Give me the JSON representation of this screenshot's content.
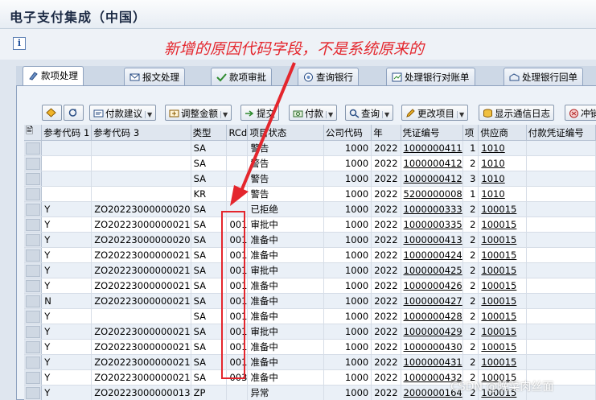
{
  "window": {
    "title": "电子支付集成（中国）"
  },
  "annotation": {
    "text": "新增的原因代码字段，不是系统原来的"
  },
  "tabs": [
    {
      "label": "款项处理",
      "icon": "pen-hand-icon"
    },
    {
      "label": "报文处理",
      "icon": "message-icon"
    },
    {
      "label": "款项审批",
      "icon": "approve-icon"
    },
    {
      "label": "查询银行",
      "icon": "bank-query-icon"
    },
    {
      "label": "处理银行对账单",
      "icon": "statement-icon"
    },
    {
      "label": "处理银行回单",
      "icon": "receipt-icon"
    }
  ],
  "toolbar": {
    "buttons": [
      {
        "label": "",
        "icon": "select-all-icon"
      },
      {
        "label": "",
        "icon": "refresh-icon"
      },
      {
        "label": "付款建议",
        "icon": "payment-proposal-icon"
      },
      {
        "label": "调整金额",
        "icon": "adjust-amount-icon"
      },
      {
        "label": "提交",
        "icon": "submit-icon"
      },
      {
        "label": "付款",
        "icon": "pay-icon"
      },
      {
        "label": "查询",
        "icon": "query-icon"
      },
      {
        "label": "更改项目",
        "icon": "edit-item-icon"
      },
      {
        "label": "显示通信日志",
        "icon": "log-icon"
      },
      {
        "label": "冲销",
        "icon": "reverse-icon"
      }
    ]
  },
  "grid": {
    "columns": [
      "参考代码 1",
      "参考代码 3",
      "类型",
      "RCd",
      "项目状态",
      "公司代码",
      "年",
      "凭证编号",
      "项",
      "供应商",
      "付款凭证编号"
    ],
    "rows": [
      [
        "",
        "",
        "SA",
        "",
        "警告",
        "1000",
        "2022",
        "1000000411",
        "1",
        "1010",
        ""
      ],
      [
        "",
        "",
        "SA",
        "",
        "警告",
        "1000",
        "2022",
        "1000000412",
        "2",
        "1010",
        ""
      ],
      [
        "",
        "",
        "SA",
        "",
        "警告",
        "1000",
        "2022",
        "1000000412",
        "3",
        "1010",
        ""
      ],
      [
        "",
        "",
        "KR",
        "",
        "警告",
        "1000",
        "2022",
        "5200000008",
        "1",
        "1010",
        ""
      ],
      [
        "Y",
        "ZO20223000000020",
        "SA",
        "",
        "已拒绝",
        "1000",
        "2022",
        "1000000333",
        "2",
        "100015",
        ""
      ],
      [
        "Y",
        "ZO20223000000021",
        "SA",
        "001",
        "审批中",
        "1000",
        "2022",
        "1000000335",
        "2",
        "100015",
        ""
      ],
      [
        "Y",
        "ZO20223000000020",
        "SA",
        "001",
        "准备中",
        "1000",
        "2022",
        "1000000413",
        "2",
        "100015",
        ""
      ],
      [
        "Y",
        "ZO20223000000021",
        "SA",
        "001",
        "准备中",
        "1000",
        "2022",
        "1000000424",
        "2",
        "100015",
        ""
      ],
      [
        "Y",
        "ZO20223000000021",
        "SA",
        "001",
        "审批中",
        "1000",
        "2022",
        "1000000425",
        "2",
        "100015",
        ""
      ],
      [
        "Y",
        "ZO20223000000021",
        "SA",
        "001",
        "准备中",
        "1000",
        "2022",
        "1000000426",
        "2",
        "100015",
        ""
      ],
      [
        "N",
        "ZO20223000000021",
        "SA",
        "001",
        "准备中",
        "1000",
        "2022",
        "1000000427",
        "2",
        "100015",
        ""
      ],
      [
        "Y",
        "",
        "SA",
        "001",
        "准备中",
        "1000",
        "2022",
        "1000000428",
        "2",
        "100015",
        ""
      ],
      [
        "Y",
        "ZO20223000000021",
        "SA",
        "001",
        "审批中",
        "1000",
        "2022",
        "1000000429",
        "2",
        "100015",
        ""
      ],
      [
        "Y",
        "ZO20223000000021",
        "SA",
        "001",
        "准备中",
        "1000",
        "2022",
        "1000000430",
        "2",
        "100015",
        ""
      ],
      [
        "Y",
        "ZO20223000000021",
        "SA",
        "001",
        "准备中",
        "1000",
        "2022",
        "1000000431",
        "2",
        "100015",
        ""
      ],
      [
        "Y",
        "ZO20223000000021",
        "SA",
        "003",
        "准备中",
        "1000",
        "2022",
        "1000000432",
        "2",
        "100015",
        ""
      ],
      [
        "Y",
        "ZO20223000000013",
        "ZP",
        "",
        "异常",
        "1000",
        "2022",
        "2000000164",
        "2",
        "100015",
        ""
      ]
    ]
  },
  "watermark": {
    "text": "CSDN @晚菜肉丝面"
  },
  "colors": {
    "annotation": "#e4262d",
    "panel": "#edf2f8"
  }
}
